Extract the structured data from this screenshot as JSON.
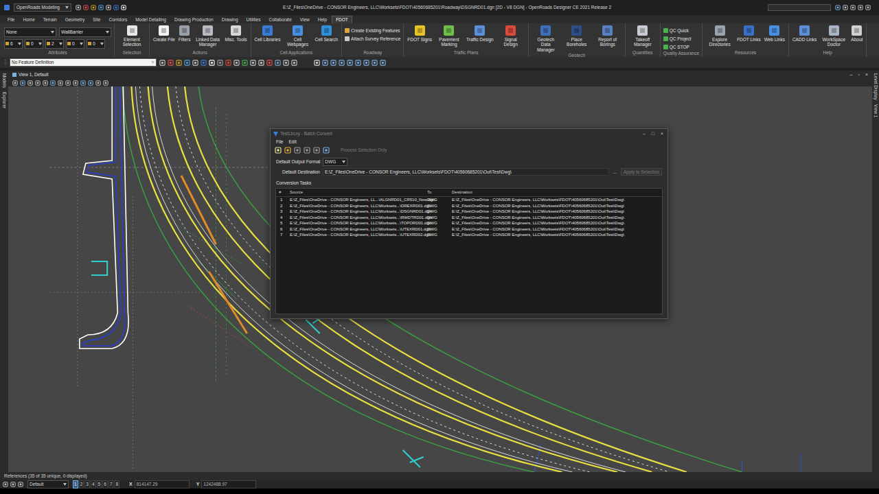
{
  "window": {
    "title": "E:\\Z_Files\\OneDrive - CONSOR Engineers, LLC\\Worksets\\FDOT\\40560685201\\Roadway\\DSGNRD01.dgn [2D - V8 DGN] - OpenRoads Designer CE 2021 Release 2",
    "workflow": "OpenRoads Modeling"
  },
  "menu_tabs": [
    {
      "label": "File",
      "selected": false
    },
    {
      "label": "Home",
      "selected": false
    },
    {
      "label": "Terrain",
      "selected": false
    },
    {
      "label": "Geometry",
      "selected": false
    },
    {
      "label": "Site",
      "selected": false
    },
    {
      "label": "Corridors",
      "selected": false
    },
    {
      "label": "Model Detailing",
      "selected": false
    },
    {
      "label": "Drawing Production",
      "selected": false
    },
    {
      "label": "Drawing",
      "selected": false
    },
    {
      "label": "Utilities",
      "selected": false
    },
    {
      "label": "Collaborate",
      "selected": false
    },
    {
      "label": "View",
      "selected": false
    },
    {
      "label": "Help",
      "selected": false
    },
    {
      "label": "FDOT",
      "selected": true
    }
  ],
  "ribbon": {
    "groups": [
      {
        "label": "Attributes",
        "items": [
          {
            "kind": "field",
            "label": "None"
          },
          {
            "kind": "field",
            "label": "WallBarrier"
          },
          {
            "kind": "field",
            "label": "6"
          },
          {
            "kind": "field",
            "label": "0"
          },
          {
            "kind": "field",
            "label": "2"
          },
          {
            "kind": "field",
            "label": "0"
          },
          {
            "kind": "field",
            "label": "0"
          }
        ]
      },
      {
        "label": "Selection",
        "items": [
          {
            "kind": "large",
            "label": "Element Selection",
            "color": "#e8e8e8"
          }
        ]
      },
      {
        "label": "Actions",
        "items": [
          {
            "kind": "large",
            "label": "Create File",
            "color": "#f2f2f2"
          },
          {
            "kind": "large",
            "label": "Filters",
            "color": "#9aa0a8"
          },
          {
            "kind": "large",
            "label": "Linked Data Manager",
            "color": "#b8bcc2"
          },
          {
            "kind": "large",
            "label": "Misc. Tools",
            "color": "#d8d8d8"
          }
        ]
      },
      {
        "label": "Cell Applications",
        "items": [
          {
            "kind": "large",
            "label": "Cell Libraries",
            "color": "#3a7bd5"
          },
          {
            "kind": "large",
            "label": "Cell Webpages",
            "color": "#4a90e2"
          },
          {
            "kind": "large",
            "label": "Cell Search",
            "color": "#2f8fd8"
          }
        ]
      },
      {
        "label": "Roadway",
        "items": [
          {
            "kind": "small",
            "label": "Create Existing Features",
            "color": "#d9a441"
          },
          {
            "kind": "small",
            "label": "Attach Survey Reference",
            "color": "#c9c9c9"
          }
        ]
      },
      {
        "label": "Traffic Plans",
        "items": [
          {
            "kind": "large",
            "label": "FDOT Signs",
            "color": "#e6c229"
          },
          {
            "kind": "large",
            "label": "Pavement Marking",
            "color": "#6fbf4a"
          },
          {
            "kind": "large",
            "label": "Traffic Design",
            "color": "#5b8fd9"
          },
          {
            "kind": "large",
            "label": "Signal Design",
            "color": "#d94a3a"
          }
        ]
      },
      {
        "label": "Geotech",
        "items": [
          {
            "kind": "large",
            "label": "Geotech Data Manager",
            "color": "#3f6fb8"
          },
          {
            "kind": "large",
            "label": "Place Boreholes",
            "color": "#2d4f86"
          },
          {
            "kind": "large",
            "label": "Report of Borings",
            "color": "#5a7fc0"
          }
        ]
      },
      {
        "label": "Quantities",
        "items": [
          {
            "kind": "large",
            "label": "Takeoff Manager",
            "color": "#c8ccd2"
          }
        ]
      },
      {
        "label": "Quality Assurance",
        "items": [
          {
            "kind": "small",
            "label": "QC Quick",
            "color": "#4caf50"
          },
          {
            "kind": "small",
            "label": "QC Project",
            "color": "#4caf50"
          },
          {
            "kind": "small",
            "label": "QC STOP",
            "color": "#4caf50"
          }
        ]
      },
      {
        "label": "Resources",
        "items": [
          {
            "kind": "large",
            "label": "Explore Directories",
            "color": "#9aa3b0"
          },
          {
            "kind": "large",
            "label": "FDOT Links",
            "color": "#3b6fc4"
          },
          {
            "kind": "large",
            "label": "Web Links",
            "color": "#4a8fe0"
          }
        ]
      },
      {
        "label": "Help",
        "items": [
          {
            "kind": "large",
            "label": "CADD Links",
            "color": "#5e8fd6"
          },
          {
            "kind": "large",
            "label": "WorkSpace Doctor",
            "color": "#aab4c2"
          },
          {
            "kind": "large",
            "label": "About",
            "color": "#d0d0d0"
          }
        ]
      }
    ]
  },
  "toolbar": {
    "feature_definition": "No Feature Definition"
  },
  "view": {
    "title": "View 1, Default",
    "controls": [
      "–",
      "▫",
      "×"
    ]
  },
  "side_tabs_left": [
    "Models",
    "Explorer"
  ],
  "side_tabs_right": [
    "Level Display",
    "View 1"
  ],
  "dialog": {
    "title": "TestLbcxy - Batch Convert",
    "controls": [
      "–",
      "□",
      "×"
    ],
    "menu": [
      "File",
      "Edit"
    ],
    "process_selection_only": {
      "label": "Process Selection Only",
      "disabled": true
    },
    "output_format": {
      "label": "Default Output Format",
      "value": "DWG"
    },
    "destination": {
      "label": "Default Destination",
      "value": "E:\\Z_Files\\OneDrive - CONSOR Engineers, LLC\\Worksets\\FDOT\\40560685201\\Out\\Test\\Dwg\\"
    },
    "browse": "...",
    "apply": {
      "label": "Apply to Selection",
      "disabled": true
    },
    "section": "Conversion Tasks",
    "columns": [
      "#",
      "Source",
      "To",
      "Destination"
    ],
    "rows": [
      {
        "num": "1",
        "source": "E:\\Z_Files\\OneDrive - CONSOR Engineers, LL...\\ALGNRD01_CR510_New.dgn",
        "to": "DWG",
        "destination": "E:\\Z_Files\\OneDrive - CONSOR Engineers, LLC\\Worksets\\FDOT\\40560685201\\Out\\Test\\Dwg\\"
      },
      {
        "num": "2",
        "source": "E:\\Z_Files\\OneDrive - CONSOR Engineers, LLC\\Worksets...\\DREXRD01.dgn",
        "to": "DWG",
        "destination": "E:\\Z_Files\\OneDrive - CONSOR Engineers, LLC\\Worksets\\FDOT\\40560685201\\Out\\Test\\Dwg\\"
      },
      {
        "num": "3",
        "source": "E:\\Z_Files\\OneDrive - CONSOR Engineers, LLC\\Worksets...\\DSGNRD01.dgn",
        "to": "DWG",
        "destination": "E:\\Z_Files\\OneDrive - CONSOR Engineers, LLC\\Worksets\\FDOT\\40560685201\\Out\\Test\\Dwg\\"
      },
      {
        "num": "4",
        "source": "E:\\Z_Files\\OneDrive - CONSOR Engineers, LLC\\Worksets...\\RWDTRD01.dgn",
        "to": "DWG",
        "destination": "E:\\Z_Files\\OneDrive - CONSOR Engineers, LLC\\Worksets\\FDOT\\40560685201\\Out\\Test\\Dwg\\"
      },
      {
        "num": "5",
        "source": "E:\\Z_Files\\OneDrive - CONSOR Engineers, LLC\\Worksets...\\TOPORD01.dgn",
        "to": "DWG",
        "destination": "E:\\Z_Files\\OneDrive - CONSOR Engineers, LLC\\Worksets\\FDOT\\40560685201\\Out\\Test\\Dwg\\"
      },
      {
        "num": "6",
        "source": "E:\\Z_Files\\OneDrive - CONSOR Engineers, LLC\\Worksets...\\UTEXRD01.dgn",
        "to": "DWG",
        "destination": "E:\\Z_Files\\OneDrive - CONSOR Engineers, LLC\\Worksets\\FDOT\\40560685201\\Out\\Test\\Dwg\\"
      },
      {
        "num": "7",
        "source": "E:\\Z_Files\\OneDrive - CONSOR Engineers, LLC\\Worksets...\\UTEXRD02.dgn",
        "to": "DWG",
        "destination": "E:\\Z_Files\\OneDrive - CONSOR Engineers, LLC\\Worksets\\FDOT\\40560685201\\Out\\Test\\Dwg\\"
      }
    ]
  },
  "status_bar": {
    "references": "References (35 of 35 unique, 0 displayed)"
  },
  "bottom_bar": {
    "level": "Default",
    "view_buttons": [
      {
        "label": "1",
        "selected": true
      },
      {
        "label": "2",
        "selected": false
      },
      {
        "label": "3",
        "selected": false
      },
      {
        "label": "4",
        "selected": false
      },
      {
        "label": "5",
        "selected": false
      },
      {
        "label": "6",
        "selected": false
      },
      {
        "label": "7",
        "selected": false
      },
      {
        "label": "8",
        "selected": false
      }
    ],
    "x_label": "X",
    "x": "814147.29",
    "y_label": "Y",
    "y": "1242488.97"
  }
}
